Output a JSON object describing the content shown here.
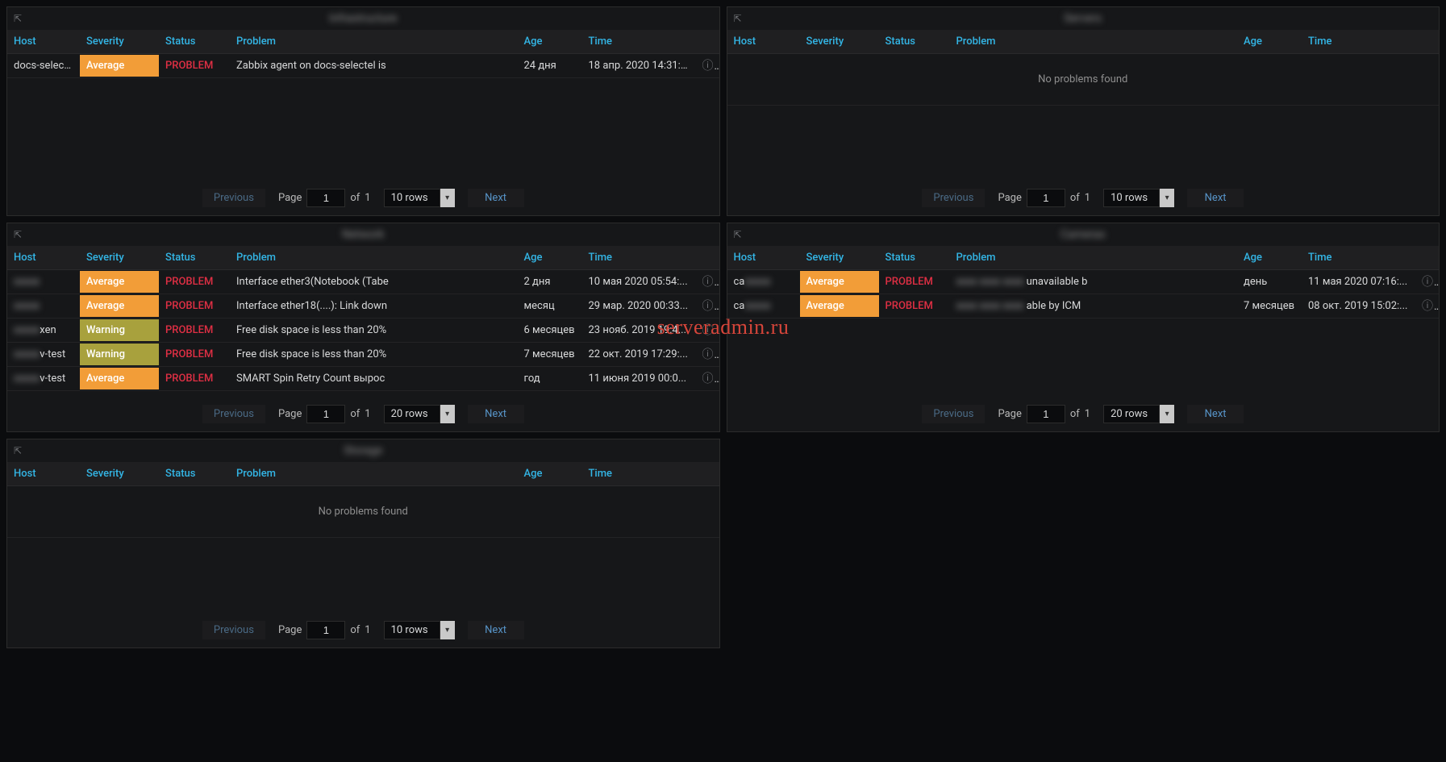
{
  "watermark": "serveradmin.ru",
  "columns": {
    "host": "Host",
    "severity": "Severity",
    "status": "Status",
    "problem": "Problem",
    "age": "Age",
    "time": "Time"
  },
  "severity_labels": {
    "average": "Average",
    "warning": "Warning"
  },
  "status_labels": {
    "problem": "PROBLEM"
  },
  "paginator": {
    "previous": "Previous",
    "next": "Next",
    "page_label": "Page",
    "of_label": "of",
    "rows10": "10 rows",
    "rows20": "20 rows"
  },
  "no_problems": "No problems found",
  "panels": [
    {
      "title": "Infrastructure",
      "page": "1",
      "total_pages": "1",
      "rows_option": "rows10",
      "rows": [
        {
          "host": "docs-selectel",
          "host_blur": false,
          "severity": "average",
          "status": "problem",
          "problem": "Zabbix agent on docs-selectel is",
          "age": "24 дня",
          "time": "18 апр. 2020 14:31:..."
        }
      ]
    },
    {
      "title": "Servers",
      "page": "1",
      "total_pages": "1",
      "rows_option": "rows10",
      "rows": []
    },
    {
      "title": "Network",
      "page": "1",
      "total_pages": "1",
      "rows_option": "rows20",
      "rows": [
        {
          "host": "router-1",
          "host_blur": true,
          "severity": "average",
          "status": "problem",
          "problem": "Interface ether3(Notebook (Tabe",
          "age": "2 дня",
          "time": "10 мая 2020 05:54:..."
        },
        {
          "host": "router-2",
          "host_blur": true,
          "severity": "average",
          "status": "problem",
          "problem": "Interface ether18(....): Link down",
          "age": "месяц",
          "time": "29 мар. 2020 00:33..."
        },
        {
          "host": "xen",
          "host_blur": true,
          "host_suffix": "xen",
          "severity": "warning",
          "status": "problem",
          "problem": "Free disk space is less than 20%",
          "age": "6 месяцев",
          "time": "23 нояб. 2019 19:4..."
        },
        {
          "host": "v-test",
          "host_blur": true,
          "host_suffix": "v-test",
          "severity": "warning",
          "status": "problem",
          "problem": "Free disk space is less than 20%",
          "age": "7 месяцев",
          "time": "22 окт. 2019 17:29:..."
        },
        {
          "host": "v-test",
          "host_blur": true,
          "host_suffix": "v-test",
          "severity": "average",
          "status": "problem",
          "problem": "SMART Spin Retry Count вырос",
          "age": "год",
          "time": "11 июня 2019 00:0..."
        }
      ]
    },
    {
      "title": "Cameras",
      "page": "1",
      "total_pages": "1",
      "rows_option": "rows20",
      "rows": [
        {
          "host": "cam-1",
          "host_blur": true,
          "host_prefix": "ca",
          "severity": "average",
          "status": "problem",
          "problem_blur": true,
          "problem_suffix": "unavailable b",
          "age": "день",
          "time": "11 мая 2020 07:16:..."
        },
        {
          "host": "cam-2",
          "host_blur": true,
          "host_prefix": "ca",
          "severity": "average",
          "status": "problem",
          "problem_blur": true,
          "problem_suffix": "able by ICM",
          "age": "7 месяцев",
          "time": "08 окт. 2019 15:02:..."
        }
      ]
    },
    {
      "title": "Storage",
      "page": "1",
      "total_pages": "1",
      "rows_option": "rows10",
      "rows": []
    }
  ]
}
